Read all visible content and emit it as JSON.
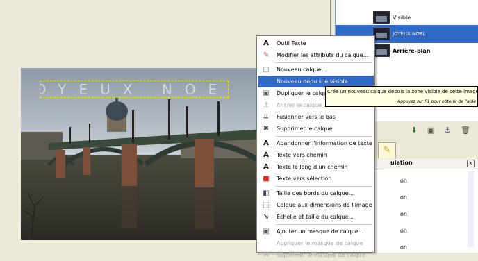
{
  "canvas": {
    "text_layer": "JOYEUX NOEL"
  },
  "layers": {
    "items": [
      {
        "name": "Visible"
      },
      {
        "name": "JOYEUX NOEL"
      },
      {
        "name": "Arrière-plan"
      }
    ],
    "buttons": [
      "new-layer-icon",
      "duplicate-icon",
      "anchor-icon",
      "delete-icon"
    ]
  },
  "undo": {
    "header": "ulation",
    "items": [
      "on",
      "on",
      "on",
      "on",
      "on"
    ]
  },
  "context_menu": {
    "items": [
      {
        "label": "Outil Texte",
        "icon": "text-tool-icon",
        "state": "normal"
      },
      {
        "label": "Modifier les attributs du calque...",
        "icon": "edit-attrs-icon",
        "state": "normal"
      },
      {
        "label": "Nouveau calque...",
        "icon": "new-layer-icon",
        "state": "normal"
      },
      {
        "label": "Nouveau depuis le visible",
        "icon": "",
        "state": "highlighted"
      },
      {
        "label": "Dupliquer le calque",
        "icon": "duplicate-icon",
        "state": "normal"
      },
      {
        "label": "Ancrer le calque",
        "icon": "anchor-icon",
        "state": "disabled"
      },
      {
        "label": "Fusionner vers le bas",
        "icon": "merge-down-icon",
        "state": "normal"
      },
      {
        "label": "Supprimer le calque",
        "icon": "delete-icon",
        "state": "normal"
      },
      {
        "label": "Abandonner l'information de texte",
        "icon": "text-icon",
        "state": "normal"
      },
      {
        "label": "Texte vers chemin",
        "icon": "text-icon",
        "state": "normal"
      },
      {
        "label": "Texte le long d'un chemin",
        "icon": "text-icon",
        "state": "normal"
      },
      {
        "label": "Texte vers sélection",
        "icon": "text-selection-icon",
        "state": "normal"
      },
      {
        "label": "Taille des bords du calque...",
        "icon": "border-size-icon",
        "state": "normal"
      },
      {
        "label": "Calque aux dimensions de l'image",
        "icon": "fit-image-icon",
        "state": "normal"
      },
      {
        "label": "Échelle et taille du calque...",
        "icon": "scale-icon",
        "state": "normal"
      },
      {
        "label": "Ajouter un masque de calque...",
        "icon": "add-mask-icon",
        "state": "normal"
      },
      {
        "label": "Appliquer le masque de calque",
        "icon": "",
        "state": "disabled"
      },
      {
        "label": "Supprimer le masque de calque",
        "icon": "",
        "state": "disabled"
      }
    ]
  },
  "tooltip": {
    "main": "Crée un nouveau calque depuis la zone visible de cette image",
    "hint": "Appuyez sur F1 pour obtenir de l'aide"
  },
  "colors": {
    "highlight": "#3169c6",
    "tooltip_bg": "#ffffe1",
    "window_bg": "#ece9d8"
  }
}
